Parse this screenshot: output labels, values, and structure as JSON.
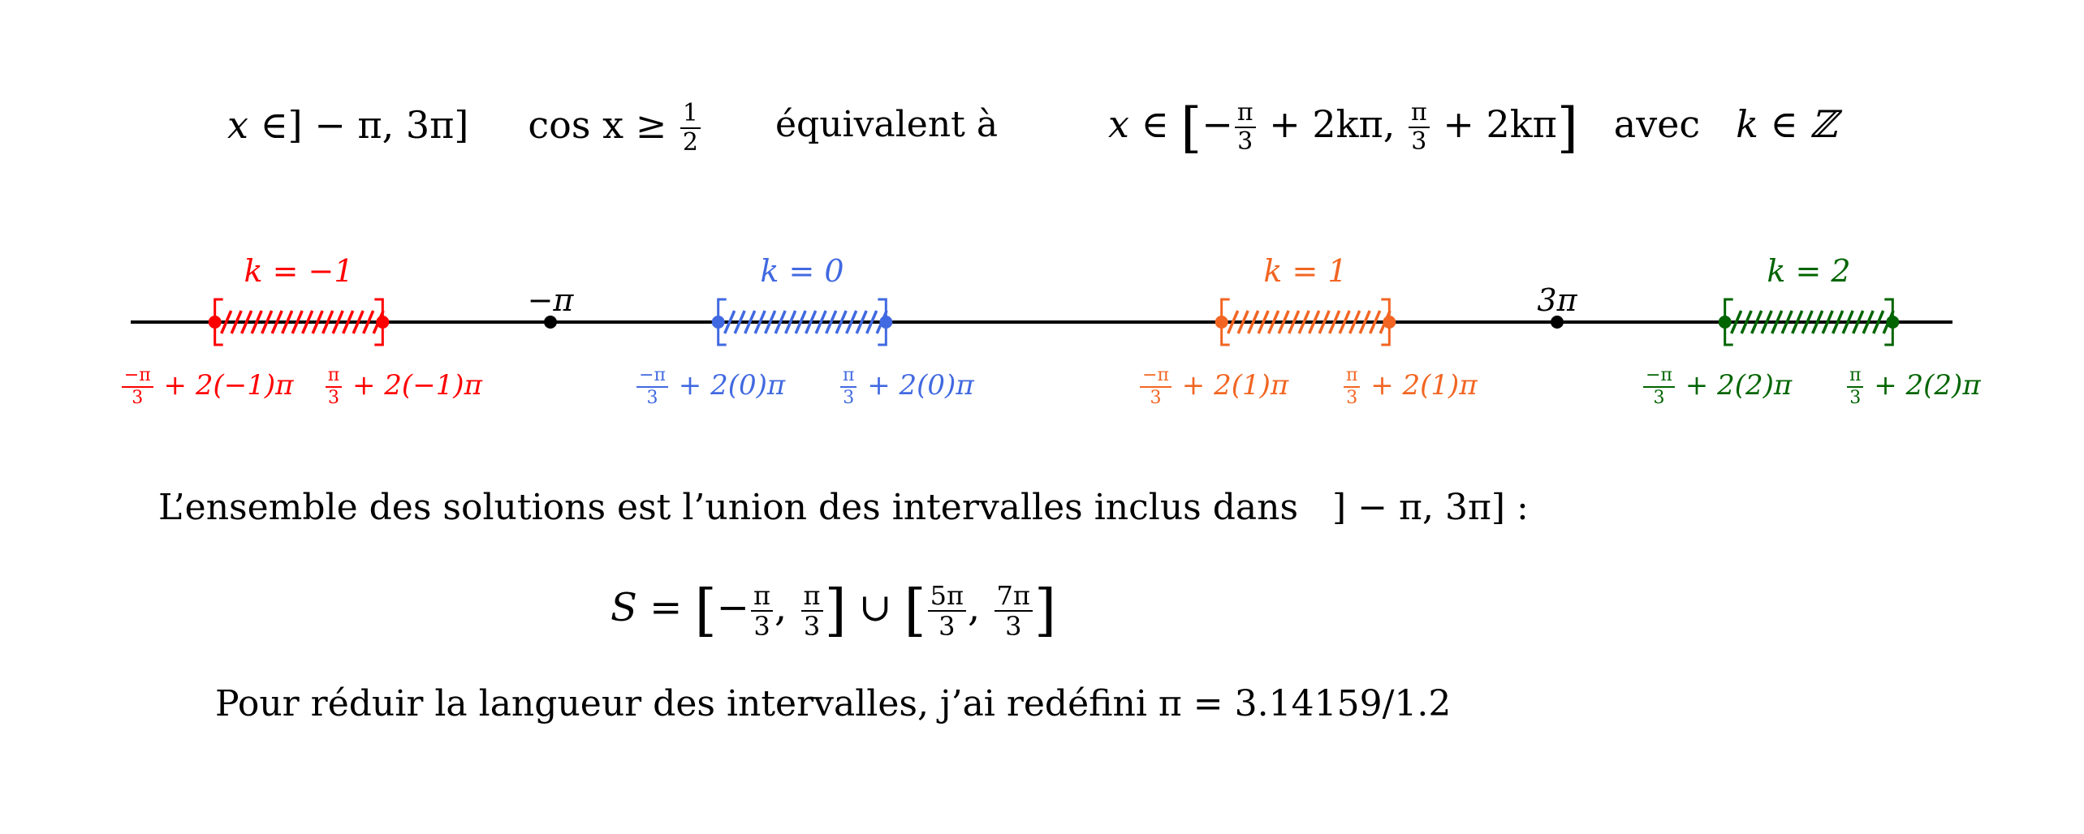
{
  "header": {
    "domain_expr": {
      "var": "x",
      "in": "∈",
      "interval": "] − π, 3π]"
    },
    "inequality": {
      "lhs": "cos x",
      "op": "≥",
      "num": "1",
      "den": "2"
    },
    "equivalent_text": "équivalent à",
    "general_solution": {
      "var": "x",
      "in": "∈",
      "open": "[",
      "left_sign": "−",
      "left_num": "π",
      "left_den": "3",
      "left_rest": "+ 2kπ,",
      "right_num": "π",
      "right_den": "3",
      "right_rest": "+ 2kπ",
      "close": "]",
      "avec": "avec",
      "k_set": "k ∈ ℤ"
    }
  },
  "chart_data": {
    "type": "number-line",
    "axis_range_pi_units": [
      -1.9,
      4.5
    ],
    "reference_points": [
      {
        "label": "−π",
        "value_pi": -1
      },
      {
        "label": "3π",
        "value_pi": 3
      }
    ],
    "intervals": [
      {
        "k": -1,
        "label": "k = −1",
        "color": "#ff0000",
        "start_pi": -2.3333,
        "end_pi": -1.6667,
        "left_label": {
          "num": "−π",
          "den": "3",
          "rest": "+ 2(−1)π"
        },
        "right_label": {
          "num": "π",
          "den": "3",
          "rest": "+ 2(−1)π"
        }
      },
      {
        "k": 0,
        "label": "k = 0",
        "color": "#4169e1",
        "start_pi": -0.3333,
        "end_pi": 0.3333,
        "left_label": {
          "num": "−π",
          "den": "3",
          "rest": "+ 2(0)π"
        },
        "right_label": {
          "num": "π",
          "den": "3",
          "rest": "+ 2(0)π"
        }
      },
      {
        "k": 1,
        "label": "k = 1",
        "color": "#f26522",
        "start_pi": 1.6667,
        "end_pi": 2.3333,
        "left_label": {
          "num": "−π",
          "den": "3",
          "rest": "+ 2(1)π"
        },
        "right_label": {
          "num": "π",
          "den": "3",
          "rest": "+ 2(1)π"
        }
      },
      {
        "k": 2,
        "label": "k = 2",
        "color": "#006400",
        "start_pi": 3.6667,
        "end_pi": 4.3333,
        "left_label": {
          "num": "−π",
          "den": "3",
          "rest": "+ 2(2)π"
        },
        "right_label": {
          "num": "π",
          "den": "3",
          "rest": "+ 2(2)π"
        }
      }
    ]
  },
  "conclusion": {
    "sentence": "L’ensemble des solutions est l’union des intervalles inclus dans",
    "sentence_interval": "] − π, 3π] :",
    "solution": {
      "lhs": "S =",
      "i1_open": "[",
      "i1_left_sign": "−",
      "i1_left_num": "π",
      "i1_left_den": "3",
      "i1_right_num": "π",
      "i1_right_den": "3",
      "i1_close": "]",
      "union": "∪",
      "i2_open": "[",
      "i2_left_num": "5π",
      "i2_left_den": "3",
      "i2_right_num": "7π",
      "i2_right_den": "3",
      "i2_close": "]"
    },
    "note": "Pour réduir la langueur des intervalles, j’ai redéfini π = 3.14159/1.2"
  }
}
